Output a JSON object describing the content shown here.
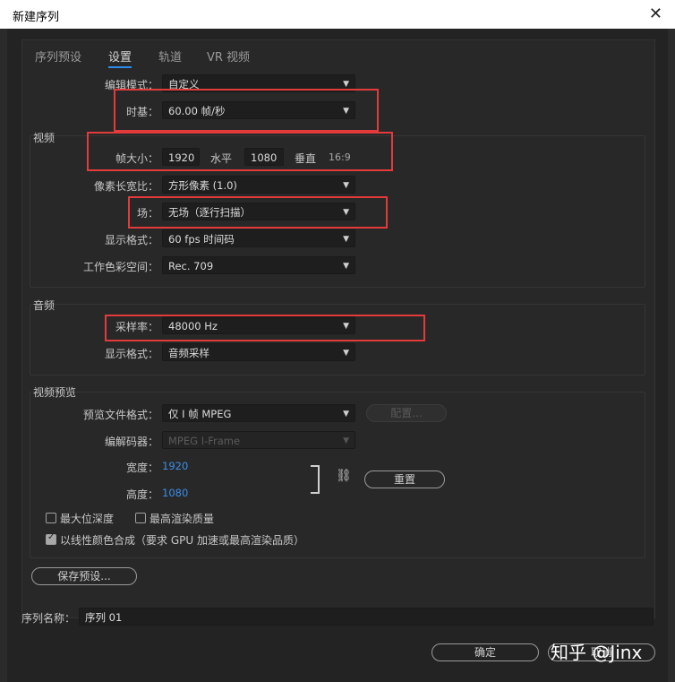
{
  "window": {
    "title": "新建序列",
    "close_glyph": "✕"
  },
  "tabs": [
    {
      "label": "序列预设"
    },
    {
      "label": "设置"
    },
    {
      "label": "轨道"
    },
    {
      "label": "VR 视频"
    }
  ],
  "settings": {
    "edit_mode_label": "编辑模式：",
    "edit_mode_value": "自定义",
    "timebase_label": "时基：",
    "timebase_value": "60.00  帧/秒"
  },
  "video": {
    "group_title": "视频",
    "frame_size_label": "帧大小：",
    "frame_width": "1920",
    "horizontal_label": "水平",
    "frame_height": "1080",
    "vertical_label": "垂直",
    "aspect": "16:9",
    "pixel_aspect_label": "像素长宽比：",
    "pixel_aspect_value": "方形像素 (1.0)",
    "fields_label": "场：",
    "fields_value": "无场（逐行扫描）",
    "display_format_label": "显示格式：",
    "display_format_value": "60 fps 时间码",
    "color_space_label": "工作色彩空间：",
    "color_space_value": "Rec. 709"
  },
  "audio": {
    "group_title": "音频",
    "sample_rate_label": "采样率：",
    "sample_rate_value": "48000 Hz",
    "display_format_label": "显示格式：",
    "display_format_value": "音频采样"
  },
  "preview": {
    "group_title": "视频预览",
    "file_format_label": "预览文件格式：",
    "file_format_value": "仅 I 帧 MPEG",
    "configure_label": "配置...",
    "codec_label": "编解码器：",
    "codec_value": "MPEG I-Frame",
    "width_label": "宽度：",
    "width_value": "1920",
    "height_label": "高度：",
    "height_value": "1080",
    "link_glyph": "⛓",
    "reset_label": "重置"
  },
  "options": {
    "max_bit_depth": "最大位深度",
    "max_render_quality": "最高渲染质量",
    "linear_color": "以线性颜色合成（要求 GPU 加速或最高渲染品质）"
  },
  "save_preset_label": "保存预设...",
  "sequence_name": {
    "label": "序列名称：",
    "value": "序列 01"
  },
  "footer": {
    "ok_label": "确定",
    "cancel_label": "取消"
  },
  "watermark": "知乎 @Jinx",
  "colors": {
    "highlight_box": "#e33b3b",
    "accent": "#2d8ceb",
    "link_value": "#3b8ee8"
  },
  "icons": [
    "close-icon",
    "chevron-down-icon",
    "link-icon",
    "checkmark-icon"
  ]
}
